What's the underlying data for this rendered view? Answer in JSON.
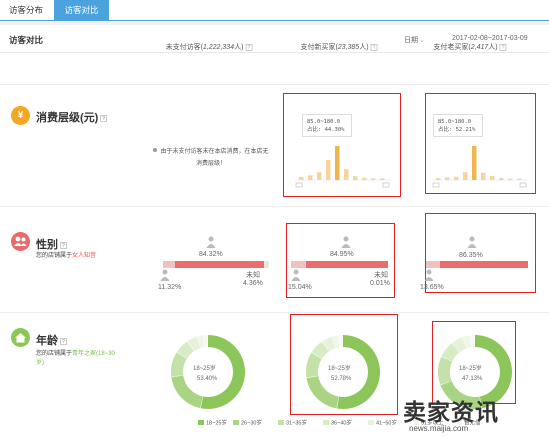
{
  "tabs": [
    {
      "label": "访客分布",
      "active": false
    },
    {
      "label": "访客对比",
      "active": true
    }
  ],
  "card": {
    "title": "访客对比",
    "range_label": "日期",
    "date_range": "2017-02-08~2017-03-09"
  },
  "columns": [
    {
      "label": "未支付访客(",
      "count": "1,222,334",
      "unit": "人)"
    },
    {
      "label": "支付新买家(",
      "count": "23,385",
      "unit": "人)"
    },
    {
      "label": "支付老买家(",
      "count": "2,417",
      "unit": "人)"
    }
  ],
  "sections": {
    "spend": {
      "icon": "¥",
      "title": "消费层级(元)",
      "note_line1": "由于未支付访客未在本店消费，在本店无",
      "note_line2": "消费层级！",
      "tooltips": [
        {
          "range": "85.0~180.0",
          "share": "占比: 44.30%"
        },
        {
          "range": "85.0~180.0",
          "share": "占比: 52.21%"
        }
      ],
      "histograms": [
        [
          0.04,
          0.06,
          0.1,
          0.26,
          0.44,
          0.14,
          0.05,
          0.03,
          0.02,
          0.02
        ],
        [
          0.03,
          0.04,
          0.05,
          0.12,
          0.52,
          0.11,
          0.06,
          0.03,
          0.02,
          0.02
        ]
      ]
    },
    "gender": {
      "title": "性别",
      "sub_prefix": "您的店铺属于",
      "sub_highlight": "女人知音",
      "cols": [
        {
          "female": "84.32%",
          "male": "11.32%",
          "unknown_label": "未知",
          "unknown": "4.36%",
          "female_val": 84.32,
          "male_val": 11.32
        },
        {
          "female": "84.95%",
          "male": "15.04%",
          "unknown_label": "未知",
          "unknown": "0.01%",
          "female_val": 84.95,
          "male_val": 15.04
        },
        {
          "female": "86.35%",
          "male": "13.65%",
          "female_val": 86.35,
          "male_val": 13.65
        }
      ]
    },
    "age": {
      "title": "年龄",
      "sub_prefix": "您的店铺属于",
      "sub_highlight": "青年之家",
      "sub_suffix": "(18~30岁)",
      "donuts": [
        {
          "center_label": "18~25岁",
          "center_value": "53.40%",
          "share": 53.4
        },
        {
          "center_label": "18~25岁",
          "center_value": "52.78%",
          "share": 52.78
        },
        {
          "center_label": "18~25岁",
          "center_value": "47.13%",
          "share": 47.13
        }
      ],
      "legend": [
        {
          "label": "18~25岁",
          "color": "#8cc65a"
        },
        {
          "label": "26~30岁",
          "color": "#a9d483"
        },
        {
          "label": "31~35岁",
          "color": "#c4e1a9"
        },
        {
          "label": "36~40岁",
          "color": "#d7ebc4"
        },
        {
          "label": "41~50岁",
          "color": "#e6f2da"
        },
        {
          "label": "51岁以上",
          "color": "#eff7e8"
        },
        {
          "label": "暂无信",
          "color": "#f6faf2"
        }
      ]
    }
  },
  "colors": {
    "tab_active": "#4aa3df",
    "spend_icon": "#f5a623",
    "gender_icon": "#e86a6a",
    "age_icon": "#8cc65a",
    "bar_orange": "#f0b451",
    "gender_bar": "#ec6c6c",
    "highlight_box": "#e02020"
  },
  "watermark": {
    "text": "卖家资讯",
    "url": "news.maijia.com"
  }
}
